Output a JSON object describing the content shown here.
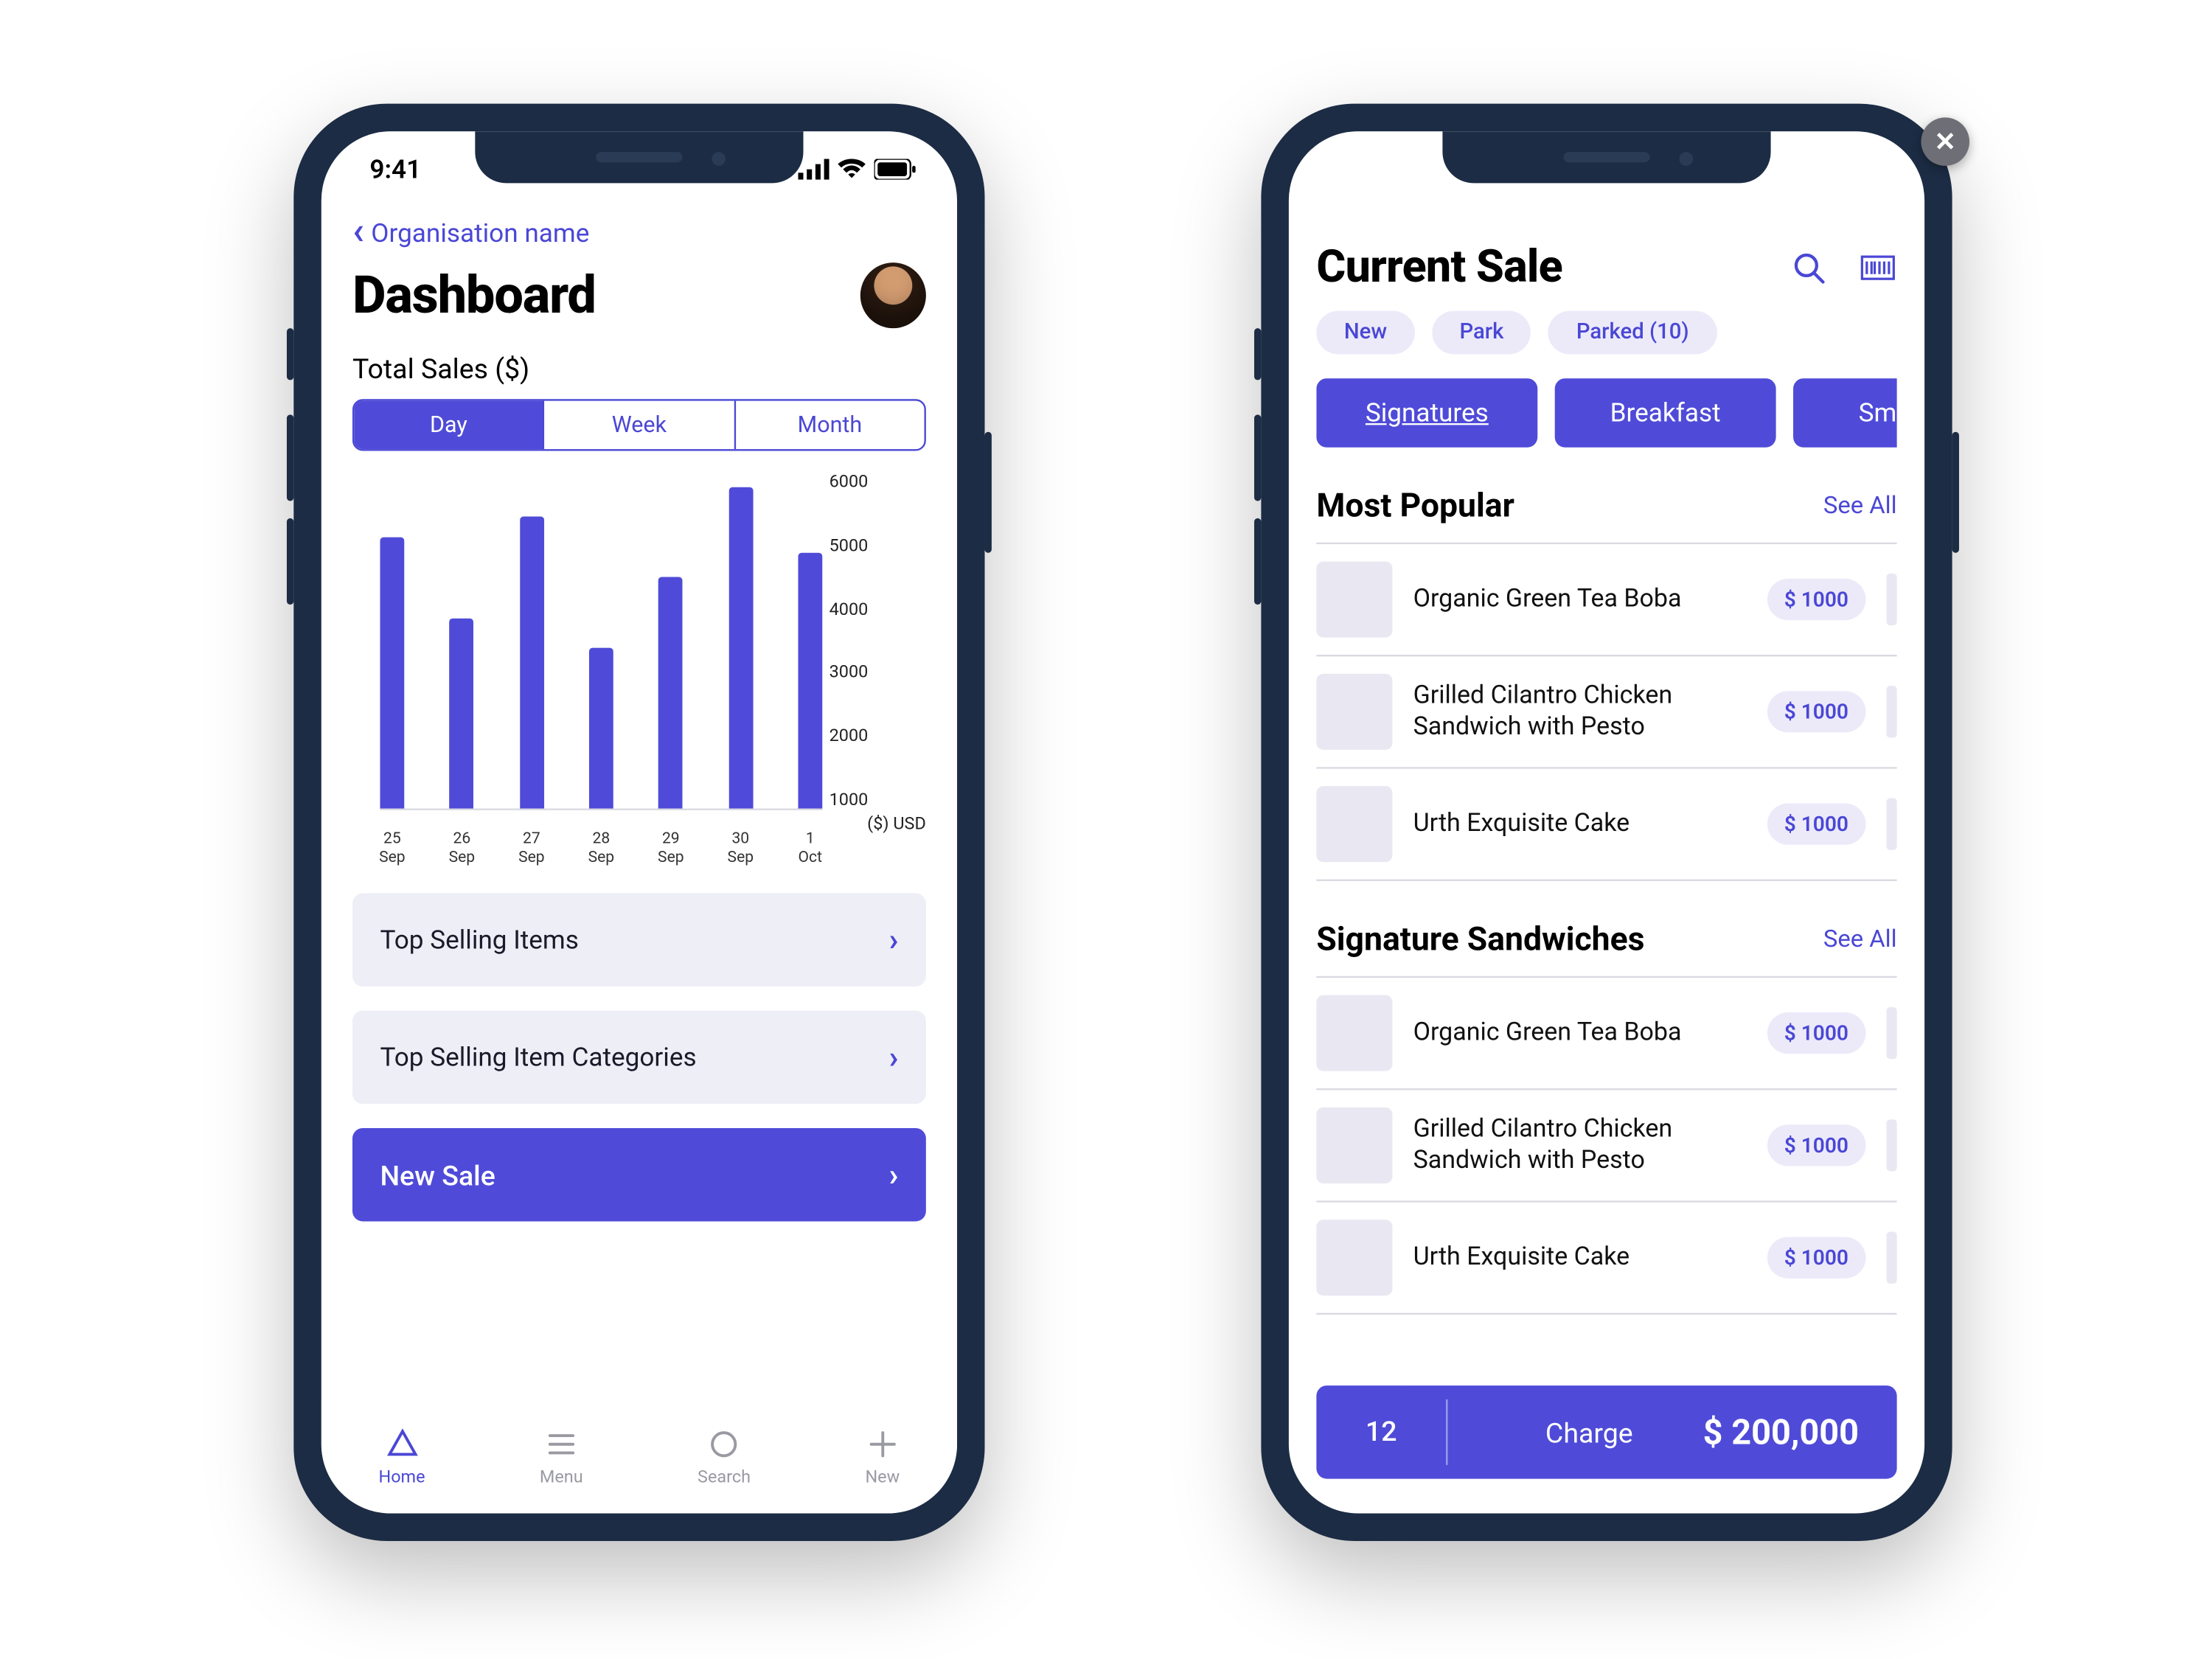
{
  "colors": {
    "accent": "#4f4bd8",
    "accent_text": "#4a47d5"
  },
  "left": {
    "status_time": "9:41",
    "back_label": "Organisation name",
    "page_title": "Dashboard",
    "total_sales_label": "Total Sales ($)",
    "segments": {
      "day": "Day",
      "week": "Week",
      "month": "Month",
      "active": "Day"
    },
    "cards": {
      "top_items": "Top Selling Items",
      "top_categories": "Top Selling Item Categories",
      "new_sale": "New Sale"
    },
    "tabs": {
      "home": "Home",
      "menu": "Menu",
      "search": "Search",
      "new": "New"
    },
    "axis_unit": "($) USD"
  },
  "right": {
    "title": "Current Sale",
    "pills": {
      "new": "New",
      "park": "Park",
      "parked": "Parked (10)"
    },
    "categories": {
      "signatures": "Signatures",
      "breakfast": "Breakfast",
      "smoothies": "Smooth"
    },
    "groups": [
      {
        "title": "Most Popular",
        "see_all": "See All",
        "items": [
          {
            "name": "Organic Green Tea Boba",
            "price": "$ 1000"
          },
          {
            "name": "Grilled Cilantro Chicken Sandwich with Pesto",
            "price": "$ 1000"
          },
          {
            "name": "Urth Exquisite Cake",
            "price": "$ 1000"
          }
        ]
      },
      {
        "title": "Signature Sandwiches",
        "see_all": "See All",
        "items": [
          {
            "name": "Organic Green Tea Boba",
            "price": "$ 1000"
          },
          {
            "name": "Grilled Cilantro Chicken Sandwich with Pesto",
            "price": "$ 1000"
          },
          {
            "name": "Urth Exquisite Cake",
            "price": "$ 1000"
          }
        ]
      }
    ],
    "charge": {
      "count": "12",
      "label": "Charge",
      "amount": "$ 200,000"
    }
  },
  "chart_data": {
    "type": "bar",
    "categories": [
      "25 Sep",
      "26 Sep",
      "27 Sep",
      "28 Sep",
      "29 Sep",
      "30 Sep",
      "1 Oct"
    ],
    "values": [
      5400,
      3800,
      5800,
      3200,
      4600,
      6400,
      5100
    ],
    "ylabel": "($) USD",
    "yticks": [
      6000,
      5000,
      4000,
      3000,
      2000,
      1000
    ],
    "ylim": [
      0,
      6500
    ]
  }
}
